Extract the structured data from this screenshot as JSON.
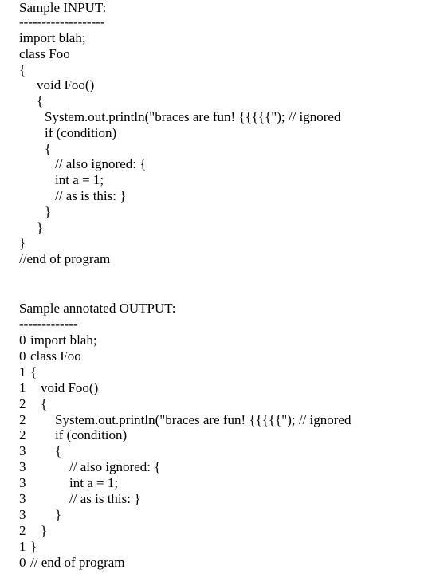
{
  "input_section": {
    "heading": "Sample INPUT:",
    "separator": "-------------------",
    "lines": [
      {
        "indent": 0,
        "text": "import blah;"
      },
      {
        "indent": 0,
        "text": "class Foo"
      },
      {
        "indent": 0,
        "text": "{"
      },
      {
        "indent": 1,
        "text": "void Foo()"
      },
      {
        "indent": 1,
        "text": "{"
      },
      {
        "indent": 2,
        "text": "System.out.println(\"braces are fun! {{{{{\"); // ignored"
      },
      {
        "indent": 2,
        "text": "if (condition)"
      },
      {
        "indent": 2,
        "text": "{"
      },
      {
        "indent": 3,
        "text": "// also ignored: {"
      },
      {
        "indent": 3,
        "text": "int a = 1;"
      },
      {
        "indent": 3,
        "text": "// as is this: }"
      },
      {
        "indent": 2,
        "text": "}"
      },
      {
        "indent": 1,
        "text": "}"
      },
      {
        "indent": 0,
        "text": "}"
      },
      {
        "indent": 0,
        "text": "//end of program"
      }
    ]
  },
  "output_section": {
    "heading": "Sample annotated OUTPUT:",
    "separator": "-------------",
    "lines": [
      {
        "depth": "0",
        "indent": 0,
        "text": "import blah;"
      },
      {
        "depth": "0",
        "indent": 0,
        "text": "class Foo"
      },
      {
        "depth": "1",
        "indent": 0,
        "text": "{"
      },
      {
        "depth": "1",
        "indent": 1,
        "text": "void Foo()"
      },
      {
        "depth": "2",
        "indent": 1,
        "text": "{"
      },
      {
        "depth": "2",
        "indent": 2,
        "text": "System.out.println(\"braces are fun! {{{{{\"); // ignored"
      },
      {
        "depth": "2",
        "indent": 2,
        "text": "if (condition)"
      },
      {
        "depth": "3",
        "indent": 2,
        "text": "{"
      },
      {
        "depth": "3",
        "indent": 3,
        "text": "// also ignored: {"
      },
      {
        "depth": "3",
        "indent": 3,
        "text": "int a = 1;"
      },
      {
        "depth": "3",
        "indent": 3,
        "text": "// as is this: }"
      },
      {
        "depth": "3",
        "indent": 2,
        "text": "}"
      },
      {
        "depth": "2",
        "indent": 1,
        "text": "}"
      },
      {
        "depth": "1",
        "indent": 0,
        "text": "}"
      },
      {
        "depth": "0",
        "indent": 0,
        "text": "// end of program"
      }
    ]
  }
}
